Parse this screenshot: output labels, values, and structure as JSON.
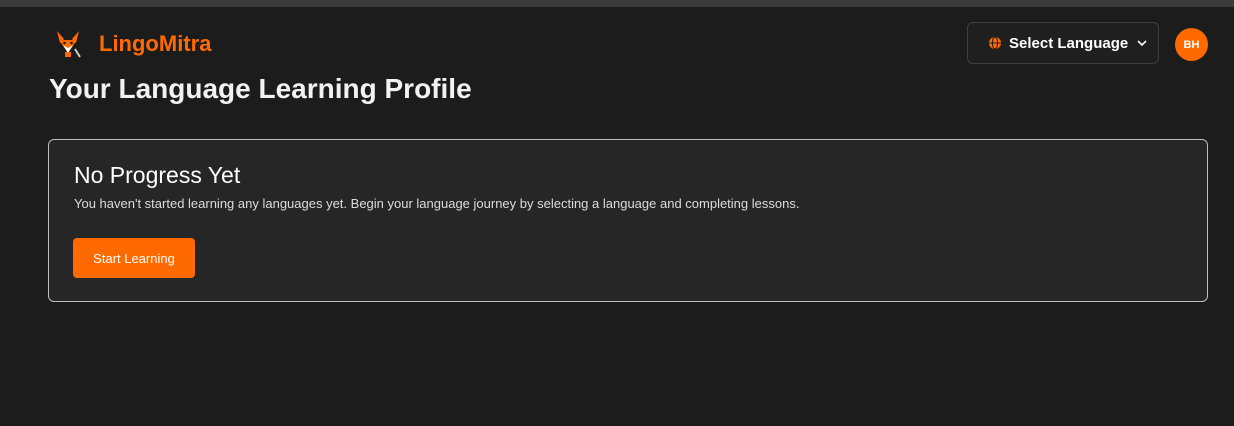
{
  "header": {
    "brand_name": "LingoMitra",
    "logo_icon": "fox-logo-icon",
    "language_selector": {
      "label": "Select Language",
      "icon": "globe-icon",
      "chevron": "chevron-down-icon"
    },
    "avatar_initials": "BH"
  },
  "main": {
    "page_title": "Your Language Learning Profile",
    "card": {
      "title": "No Progress Yet",
      "description": "You haven't started learning any languages yet. Begin your language journey by selecting a language and completing lessons.",
      "button_label": "Start Learning"
    }
  },
  "colors": {
    "accent": "#ff6a00",
    "background": "#1c1c1c",
    "card_background": "#262626"
  }
}
